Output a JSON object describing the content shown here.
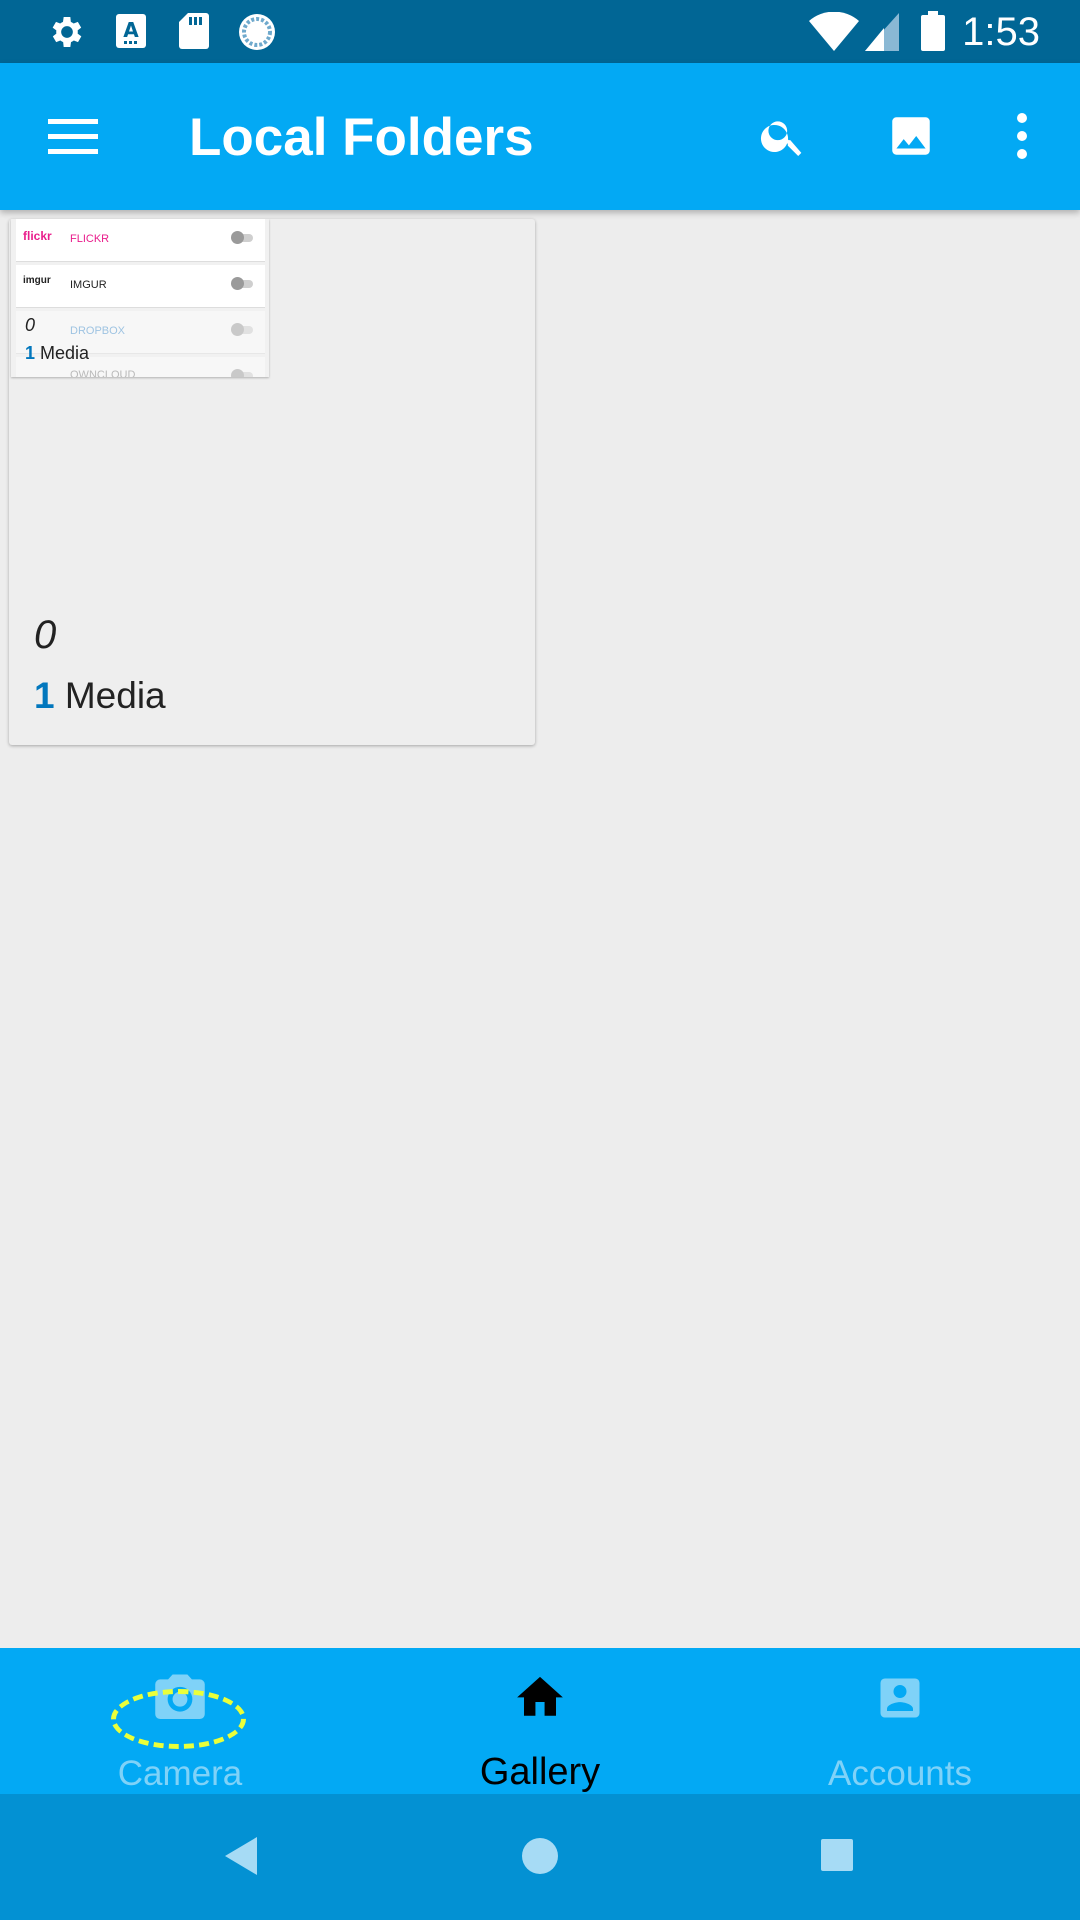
{
  "status_bar": {
    "time": "1:53",
    "left_icons": [
      "settings-icon",
      "keyboard-a-icon",
      "sd-card-icon",
      "sync-icon"
    ],
    "right_icons": [
      "wifi-icon",
      "cellular-signal-icon",
      "battery-icon"
    ]
  },
  "app_bar": {
    "title": "Local Folders",
    "icons": [
      "menu-icon",
      "search-icon",
      "image-icon",
      "more-vert-icon"
    ]
  },
  "folder_card": {
    "count": "0",
    "media_count": "1",
    "media_label": "Media",
    "thumbnail": {
      "rows": [
        {
          "logo": "flickr",
          "label": "FLICKR",
          "color": "#e91e8c"
        },
        {
          "logo": "imgur",
          "label": "IMGUR",
          "color": "#222222"
        },
        {
          "logo": "",
          "label": "DROPBOX",
          "color": "#9ec9e6"
        },
        {
          "logo": "",
          "label": "OWNCLOUD",
          "color": "#bbbbbb"
        }
      ],
      "count": "0",
      "media_count": "1",
      "media_label": "Media"
    }
  },
  "bottom_nav": {
    "items": [
      {
        "label": "Camera",
        "icon": "camera-icon",
        "active": false
      },
      {
        "label": "Gallery",
        "icon": "home-icon",
        "active": true
      },
      {
        "label": "Accounts",
        "icon": "account-box-icon",
        "active": false
      }
    ]
  },
  "system_nav": {
    "icons": [
      "back-icon",
      "home-circle-icon",
      "recents-icon"
    ]
  },
  "colors": {
    "status_bar": "#016695",
    "app_bar": "#03a9f4",
    "system_nav": "#0391d3",
    "accent_number": "#0277bd",
    "highlight": "#eaff3a"
  }
}
